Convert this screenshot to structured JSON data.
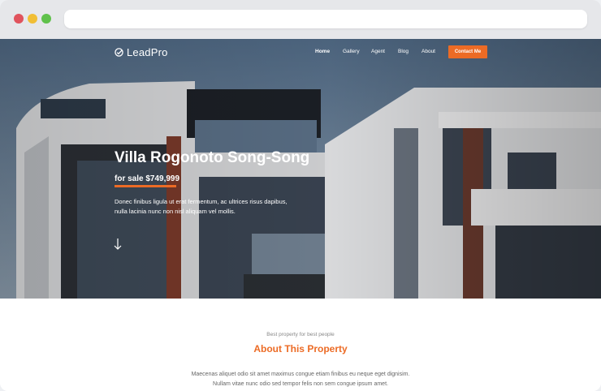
{
  "brand": {
    "name": "LeadPro",
    "accent": "#ec6b25"
  },
  "nav": {
    "items": [
      "Home",
      "Gallery",
      "Agent",
      "Blog",
      "About"
    ],
    "active": "Home",
    "cta": "Contact Me"
  },
  "hero": {
    "title": "Villa Rogonoto Song-Song",
    "price": "for sale $749,999",
    "description_line1": "Donec finibus ligula ut erat fermentum, ac ultrices risus dapibus,",
    "description_line2": "nulla lacinia nunc non nisl aliquam vel mollis.",
    "scroll_icon": "arrow-down-icon"
  },
  "about": {
    "subtitle": "Best property for best people",
    "title": "About This Property",
    "text_line1": "Maecenas aliquet odio sit amet maximus congue etiam finibus eu neque eget dignisim.",
    "text_line2": "Nullam vitae nunc odio sed tempor felis non sem congue ipsum amet."
  }
}
